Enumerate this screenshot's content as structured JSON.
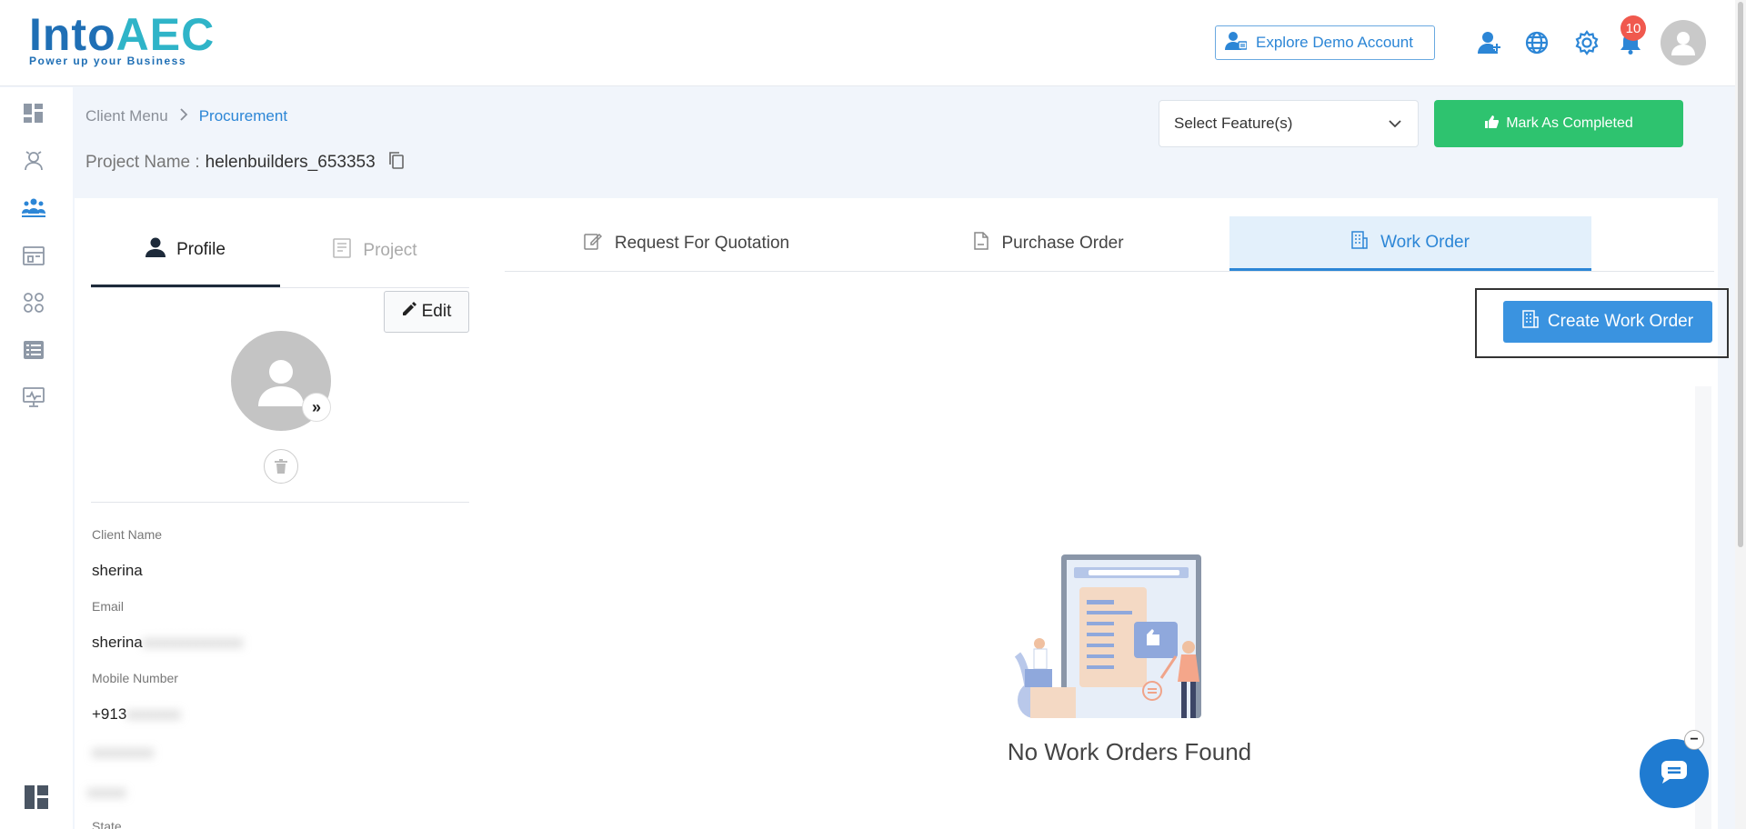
{
  "header": {
    "logo_text_into": "Into",
    "logo_text_aec": "AEC",
    "logo_tagline": "Power up your Business",
    "demo_button_label": "Explore Demo Account",
    "notification_count": "10",
    "icons": [
      "add-user-icon",
      "globe-icon",
      "gear-icon",
      "bell-icon",
      "user-avatar-icon"
    ]
  },
  "sidebar": {
    "items": [
      "dashboard-icon",
      "clients-icon",
      "team-icon",
      "store-icon",
      "modules-icon",
      "list-icon",
      "monitor-icon"
    ],
    "active_index": 2,
    "bottom_icon": "layout-icon"
  },
  "breadcrumb": {
    "parent": "Client Menu",
    "current": "Procurement"
  },
  "project": {
    "label": "Project Name :",
    "name": "helenbuilders_653353"
  },
  "actions": {
    "feature_select_value": "Select Feature(s)",
    "complete_button_label": "Mark As Completed"
  },
  "profile_panel": {
    "tabs": [
      "Profile",
      "Project"
    ],
    "active_tab": "Profile",
    "edit_label": "Edit",
    "fields": [
      {
        "label": "Client Name",
        "value": "sherina"
      },
      {
        "label": "Email",
        "value": "sherina",
        "blurred_suffix": "xxxxxxxxxxxxx"
      },
      {
        "label": "Mobile Number",
        "value": "+913",
        "blurred_suffix": "xxxxxxx"
      }
    ],
    "blurred_rows": [
      "xxxxxxxx",
      "xxxxx"
    ],
    "last_label": "State"
  },
  "main_panel": {
    "tabs": [
      "Request For Quotation",
      "Purchase Order",
      "Work Order"
    ],
    "active_tab": "Work Order",
    "create_button_label": "Create Work Order",
    "empty_message": "No Work Orders Found"
  },
  "chat": {
    "minimize_label": "−"
  },
  "colors": {
    "brand_blue": "#2c86d6",
    "success_green": "#2ec36f",
    "badge_red": "#f0594e"
  }
}
